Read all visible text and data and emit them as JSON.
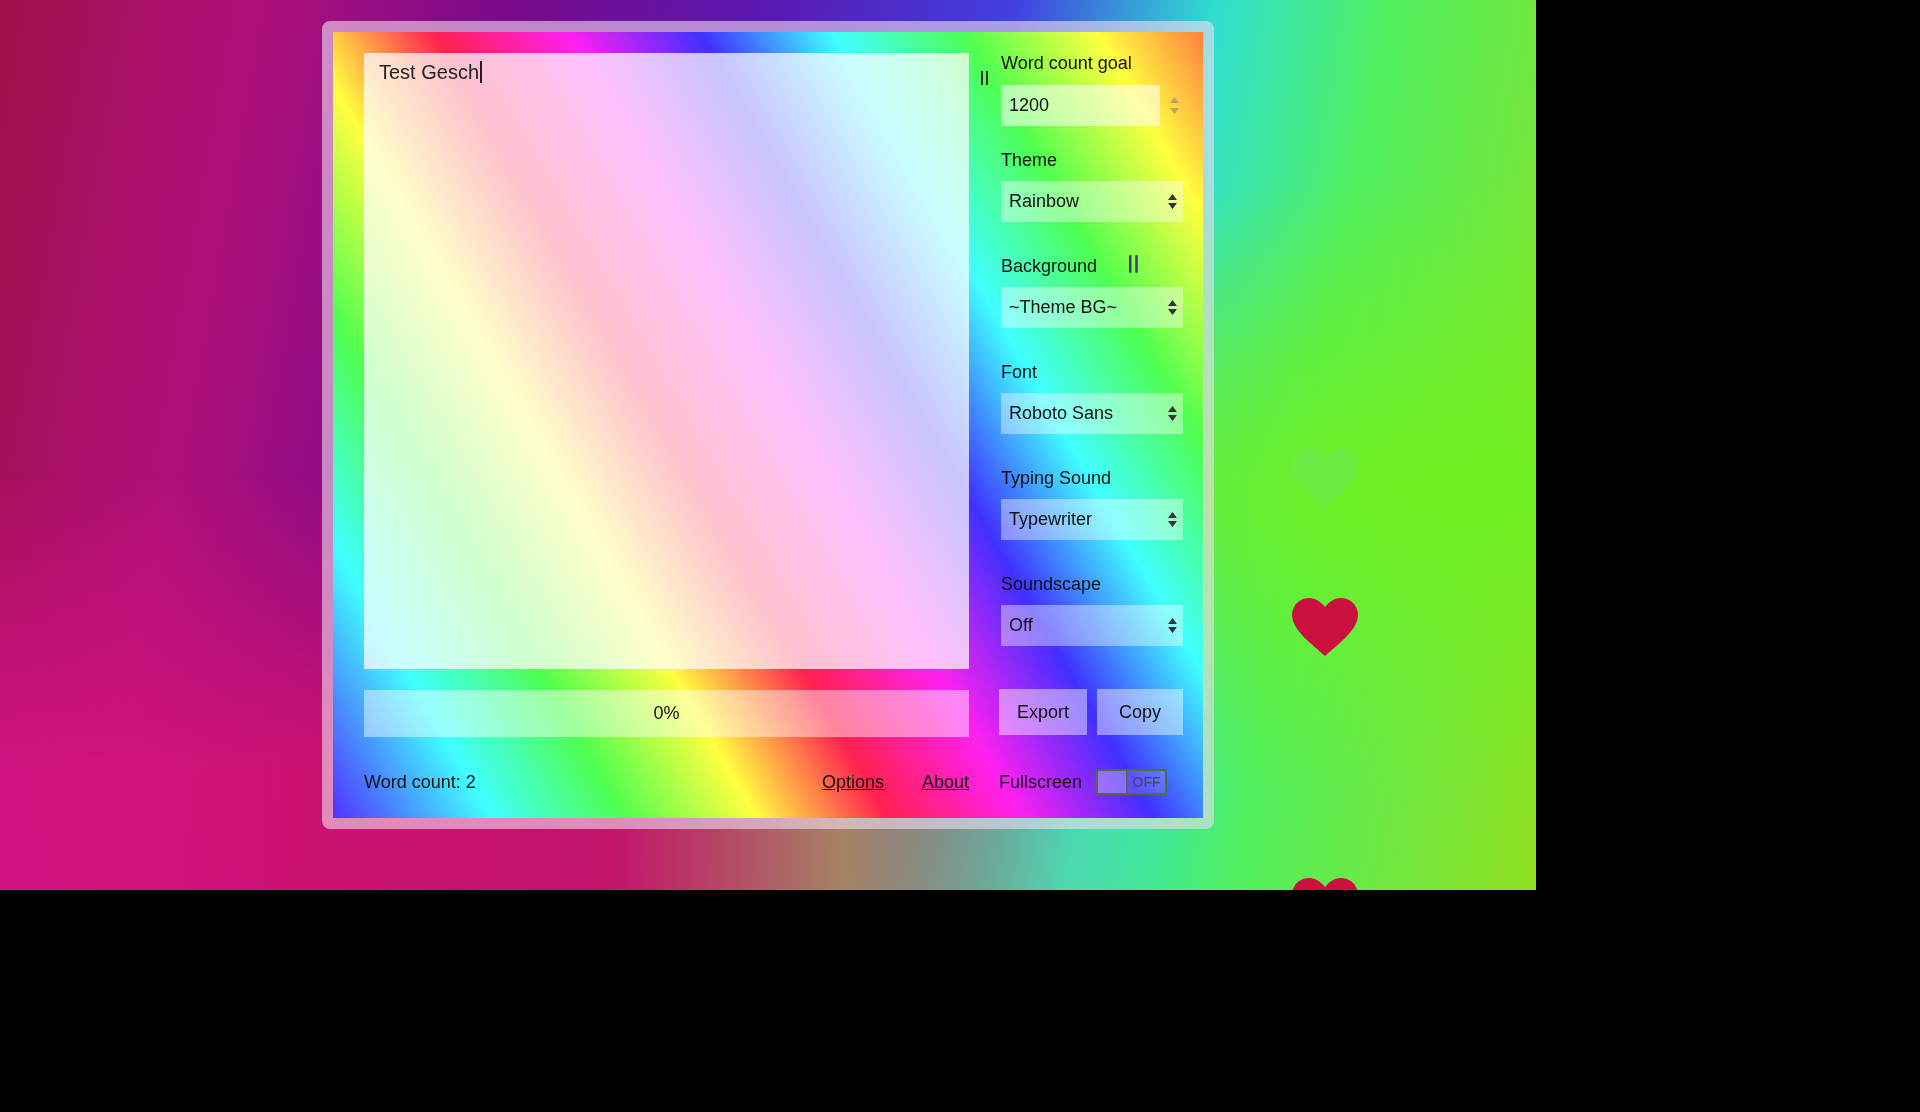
{
  "editor": {
    "text": "Test Gesch"
  },
  "progress": {
    "level": 0,
    "reading": "0%"
  },
  "settings": {
    "word_count_goal": {
      "label": "Word count goal",
      "value": "1200"
    },
    "selects": [
      {
        "label": "Theme",
        "value": "Rainbow",
        "paused": false
      },
      {
        "label": "Background",
        "value": "~Theme BG~",
        "paused": true
      },
      {
        "label": "Font",
        "value": "Roboto Sans",
        "paused": false
      },
      {
        "label": "Typing Sound",
        "value": "Typewriter",
        "paused": false
      },
      {
        "label": "Soundscape",
        "value": "Off",
        "paused": false
      }
    ]
  },
  "buttons": [
    "Export",
    "Copy"
  ],
  "footer": {
    "word_count": "Word count: 2",
    "links": [
      "Options",
      "About"
    ],
    "fullscreen": {
      "label": "Fullscreen",
      "on": false,
      "state_text": "OFF"
    }
  }
}
